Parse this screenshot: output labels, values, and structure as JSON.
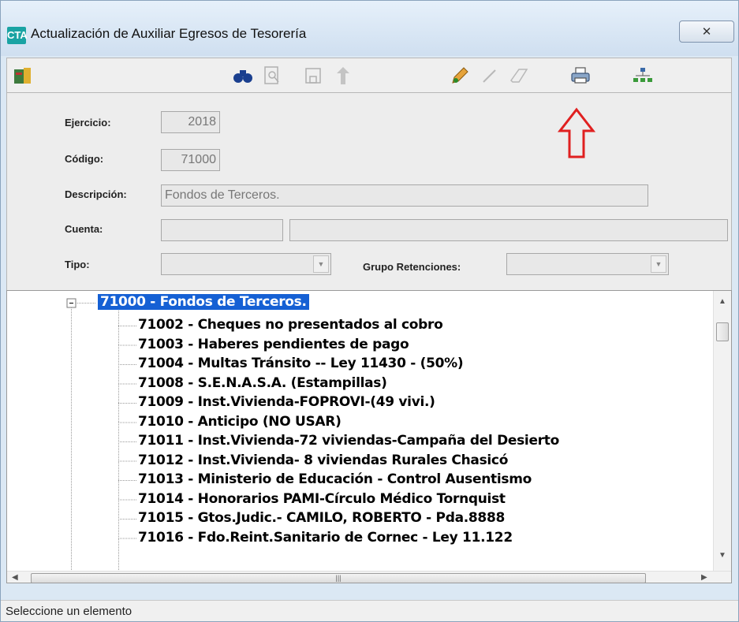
{
  "window": {
    "app_icon_text": "CTA",
    "title": "Actualización de Auxiliar Egresos de Tesorería",
    "close_label": "✕"
  },
  "toolbar": {
    "icons": [
      "exit-icon",
      "binoculars-icon",
      "zoom-icon",
      "save-icon",
      "upload-icon",
      "edit-pencil-icon",
      "pen-icon",
      "eraser-icon",
      "printer-icon",
      "tree-structure-icon"
    ]
  },
  "form": {
    "ejercicio_label": "Ejercicio:",
    "ejercicio_value": "2018",
    "codigo_label": "Código:",
    "codigo_value": "71000",
    "descripcion_label": "Descripción:",
    "descripcion_value": "Fondos de Terceros.",
    "cuenta_label": "Cuenta:",
    "cuenta_value_1": "",
    "cuenta_value_2": "",
    "tipo_label": "Tipo:",
    "tipo_value": "",
    "grupo_label": "Grupo Retenciones:",
    "grupo_value": ""
  },
  "annotation": {
    "arrow_color": "#e02020"
  },
  "tree": {
    "root": "71000 - Fondos de Terceros.",
    "items": [
      "71002 - Cheques no presentados al cobro",
      "71003 - Haberes pendientes de pago",
      "71004 - Multas Tránsito -- Ley 11430 - (50%)",
      "71008 - S.E.N.A.S.A. (Estampillas)",
      "71009 - Inst.Vivienda-FOPROVI-(49 vivi.)",
      "71010 - Anticipo  (NO USAR)",
      "71011 - Inst.Vivienda-72 viviendas-Campaña del Desierto",
      "71012 - Inst.Vivienda- 8 viviendas Rurales Chasicó",
      "71013 - Ministerio de Educación - Control Ausentismo",
      "71014 - Honorarios PAMI-Círculo Médico Tornquist",
      "71015 - Gtos.Judic.- CAMILO, ROBERTO - Pda.8888",
      "71016 - Fdo.Reint.Sanitario de Cornec - Ley 11.122"
    ]
  },
  "status": {
    "text": "Seleccione un elemento"
  }
}
